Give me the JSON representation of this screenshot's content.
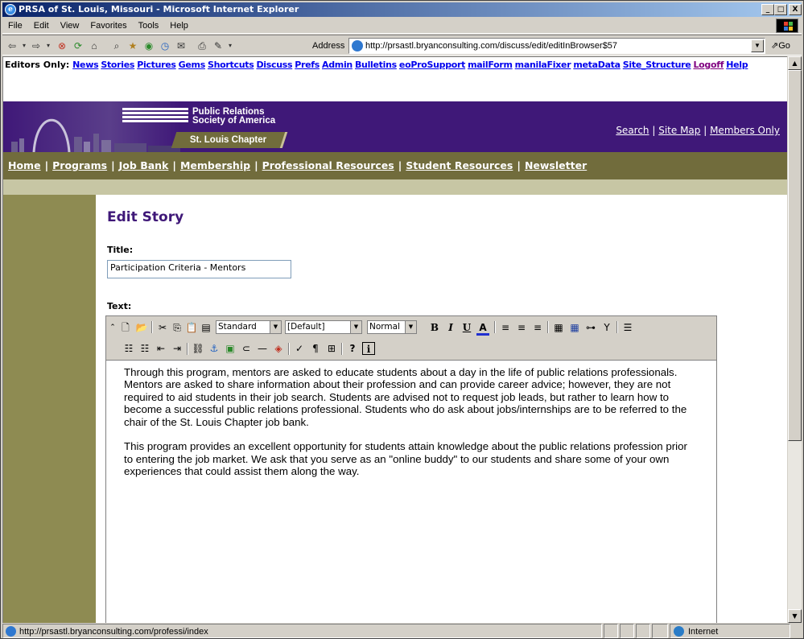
{
  "window": {
    "title": "PRSA of St. Louis, Missouri - Microsoft Internet Explorer",
    "controls": [
      "_",
      "□",
      "X"
    ]
  },
  "menu": [
    "File",
    "Edit",
    "View",
    "Favorites",
    "Tools",
    "Help"
  ],
  "toolbar": {
    "address_label": "Address",
    "url": "http://prsastl.bryanconsulting.com/discuss/edit/editInBrowser$57",
    "go_label": "Go"
  },
  "editors_bar": {
    "label": "Editors Only:",
    "links": [
      "News",
      "Stories",
      "Pictures",
      "Gems",
      "Shortcuts",
      "Discuss",
      "Prefs",
      "Admin",
      "Bulletins",
      "eoProSupport",
      "mailForm",
      "manilaFixer",
      "metaData",
      "Site_Structure",
      "Logoff",
      "Help"
    ]
  },
  "banner": {
    "logo_line1": "Public Relations",
    "logo_line2": "Society of America",
    "chapter": "St. Louis Chapter",
    "top_links": [
      "Search",
      "Site Map",
      "Members Only"
    ]
  },
  "nav": [
    "Home",
    "Programs",
    "Job Bank",
    "Membership",
    "Professional Resources",
    "Student Resources",
    "Newsletter"
  ],
  "form": {
    "heading": "Edit Story",
    "title_label": "Title:",
    "title_value": "Participation Criteria - Mentors",
    "text_label": "Text:",
    "style_select": "Standard",
    "font_select": "[Default]",
    "size_select": "Normal",
    "paragraphs": [
      "Through this program, mentors are asked to educate students about a day in the life of public relations professionals.  Mentors are asked to share information about their profession and can provide career advice; however, they are not required to aid students in their job search. Students are advised not to request job leads, but rather to learn how to become a successful public relations professional.  Students who do ask about jobs/internships are to be referred to the chair of the St. Louis Chapter job bank.",
      "This program provides an excellent opportunity for students attain knowledge about the public relations profession prior to entering the job market.  We ask that you serve as an \"online buddy\" to our students and share some of your own experiences that could assist them along the way."
    ]
  },
  "status": {
    "url": "http://prsastl.bryanconsulting.com/professi/index",
    "zone": "Internet"
  }
}
